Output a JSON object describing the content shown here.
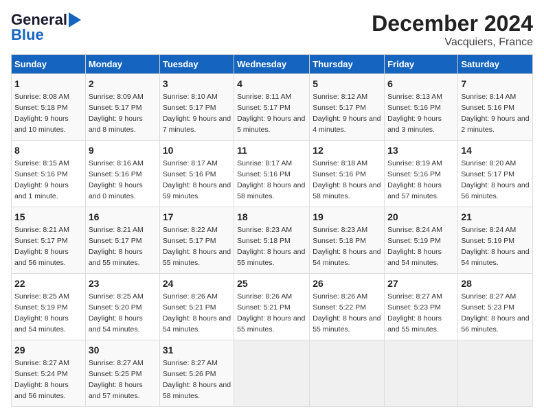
{
  "header": {
    "logo_line1": "General",
    "logo_line2": "Blue",
    "title": "December 2024",
    "subtitle": "Vacquiers, France"
  },
  "days_of_week": [
    "Sunday",
    "Monday",
    "Tuesday",
    "Wednesday",
    "Thursday",
    "Friday",
    "Saturday"
  ],
  "weeks": [
    [
      {
        "day": 1,
        "sunrise": "8:08 AM",
        "sunset": "5:18 PM",
        "daylight": "9 hours and 10 minutes."
      },
      {
        "day": 2,
        "sunrise": "8:09 AM",
        "sunset": "5:17 PM",
        "daylight": "9 hours and 8 minutes."
      },
      {
        "day": 3,
        "sunrise": "8:10 AM",
        "sunset": "5:17 PM",
        "daylight": "9 hours and 7 minutes."
      },
      {
        "day": 4,
        "sunrise": "8:11 AM",
        "sunset": "5:17 PM",
        "daylight": "9 hours and 5 minutes."
      },
      {
        "day": 5,
        "sunrise": "8:12 AM",
        "sunset": "5:17 PM",
        "daylight": "9 hours and 4 minutes."
      },
      {
        "day": 6,
        "sunrise": "8:13 AM",
        "sunset": "5:16 PM",
        "daylight": "9 hours and 3 minutes."
      },
      {
        "day": 7,
        "sunrise": "8:14 AM",
        "sunset": "5:16 PM",
        "daylight": "9 hours and 2 minutes."
      }
    ],
    [
      {
        "day": 8,
        "sunrise": "8:15 AM",
        "sunset": "5:16 PM",
        "daylight": "9 hours and 1 minute."
      },
      {
        "day": 9,
        "sunrise": "8:16 AM",
        "sunset": "5:16 PM",
        "daylight": "9 hours and 0 minutes."
      },
      {
        "day": 10,
        "sunrise": "8:17 AM",
        "sunset": "5:16 PM",
        "daylight": "8 hours and 59 minutes."
      },
      {
        "day": 11,
        "sunrise": "8:17 AM",
        "sunset": "5:16 PM",
        "daylight": "8 hours and 58 minutes."
      },
      {
        "day": 12,
        "sunrise": "8:18 AM",
        "sunset": "5:16 PM",
        "daylight": "8 hours and 58 minutes."
      },
      {
        "day": 13,
        "sunrise": "8:19 AM",
        "sunset": "5:16 PM",
        "daylight": "8 hours and 57 minutes."
      },
      {
        "day": 14,
        "sunrise": "8:20 AM",
        "sunset": "5:17 PM",
        "daylight": "8 hours and 56 minutes."
      }
    ],
    [
      {
        "day": 15,
        "sunrise": "8:21 AM",
        "sunset": "5:17 PM",
        "daylight": "8 hours and 56 minutes."
      },
      {
        "day": 16,
        "sunrise": "8:21 AM",
        "sunset": "5:17 PM",
        "daylight": "8 hours and 55 minutes."
      },
      {
        "day": 17,
        "sunrise": "8:22 AM",
        "sunset": "5:17 PM",
        "daylight": "8 hours and 55 minutes."
      },
      {
        "day": 18,
        "sunrise": "8:23 AM",
        "sunset": "5:18 PM",
        "daylight": "8 hours and 55 minutes."
      },
      {
        "day": 19,
        "sunrise": "8:23 AM",
        "sunset": "5:18 PM",
        "daylight": "8 hours and 54 minutes."
      },
      {
        "day": 20,
        "sunrise": "8:24 AM",
        "sunset": "5:19 PM",
        "daylight": "8 hours and 54 minutes."
      },
      {
        "day": 21,
        "sunrise": "8:24 AM",
        "sunset": "5:19 PM",
        "daylight": "8 hours and 54 minutes."
      }
    ],
    [
      {
        "day": 22,
        "sunrise": "8:25 AM",
        "sunset": "5:19 PM",
        "daylight": "8 hours and 54 minutes."
      },
      {
        "day": 23,
        "sunrise": "8:25 AM",
        "sunset": "5:20 PM",
        "daylight": "8 hours and 54 minutes."
      },
      {
        "day": 24,
        "sunrise": "8:26 AM",
        "sunset": "5:21 PM",
        "daylight": "8 hours and 54 minutes."
      },
      {
        "day": 25,
        "sunrise": "8:26 AM",
        "sunset": "5:21 PM",
        "daylight": "8 hours and 55 minutes."
      },
      {
        "day": 26,
        "sunrise": "8:26 AM",
        "sunset": "5:22 PM",
        "daylight": "8 hours and 55 minutes."
      },
      {
        "day": 27,
        "sunrise": "8:27 AM",
        "sunset": "5:23 PM",
        "daylight": "8 hours and 55 minutes."
      },
      {
        "day": 28,
        "sunrise": "8:27 AM",
        "sunset": "5:23 PM",
        "daylight": "8 hours and 56 minutes."
      }
    ],
    [
      {
        "day": 29,
        "sunrise": "8:27 AM",
        "sunset": "5:24 PM",
        "daylight": "8 hours and 56 minutes."
      },
      {
        "day": 30,
        "sunrise": "8:27 AM",
        "sunset": "5:25 PM",
        "daylight": "8 hours and 57 minutes."
      },
      {
        "day": 31,
        "sunrise": "8:27 AM",
        "sunset": "5:26 PM",
        "daylight": "8 hours and 58 minutes."
      },
      null,
      null,
      null,
      null
    ]
  ]
}
